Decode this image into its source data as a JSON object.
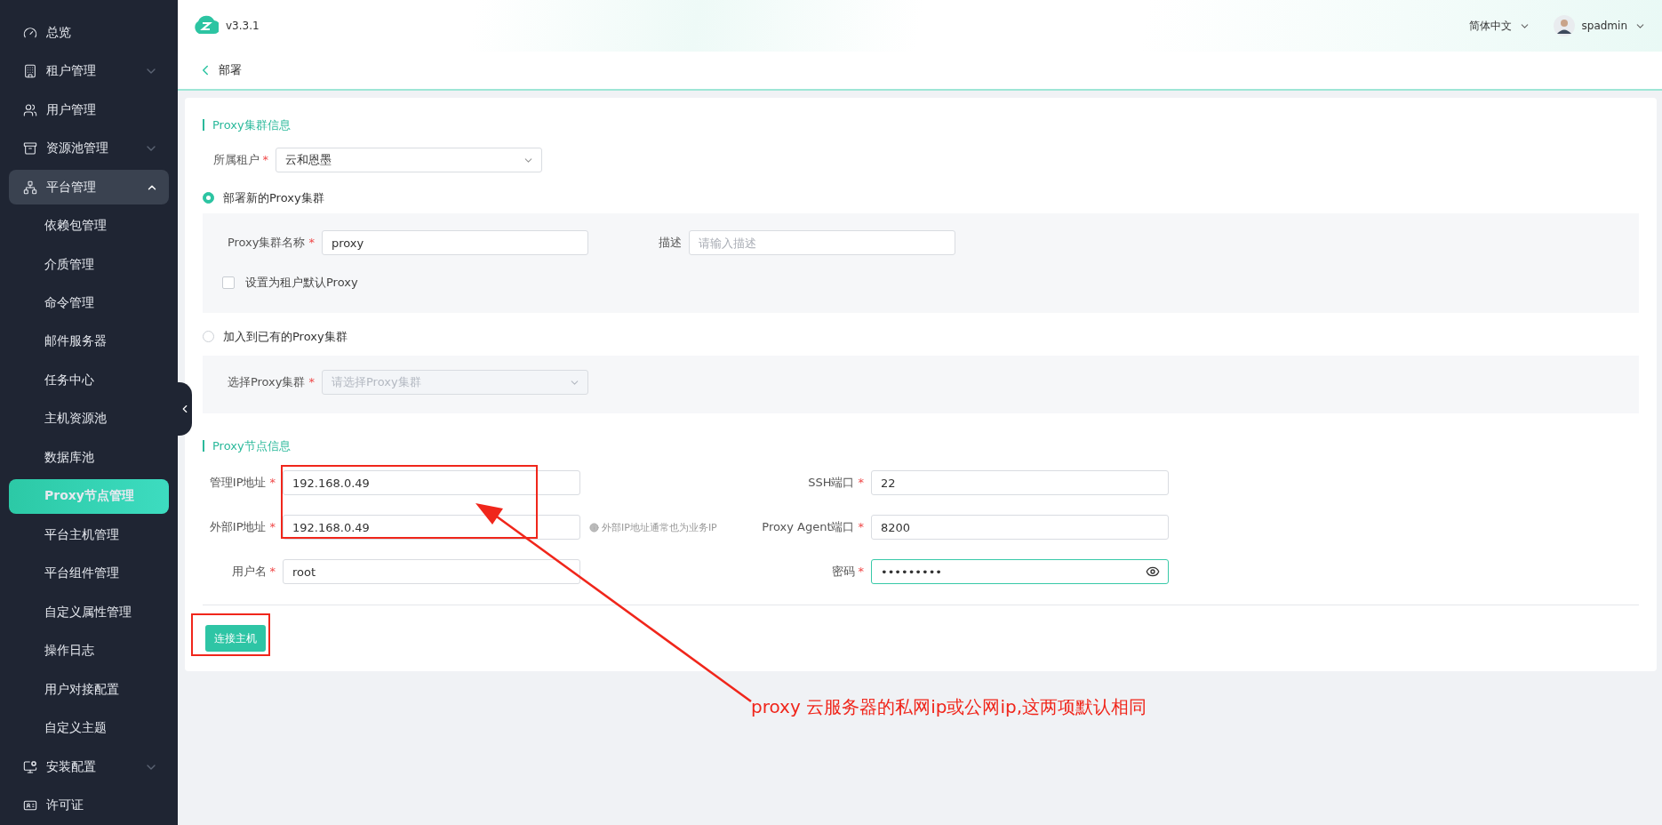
{
  "sidebar": {
    "items": [
      {
        "label": "总览",
        "selected": false
      },
      {
        "label": "租户管理",
        "selected": false,
        "expanded": false
      },
      {
        "label": "用户管理",
        "selected": false
      },
      {
        "label": "资源池管理",
        "selected": false,
        "expanded": false
      },
      {
        "label": "平台管理",
        "selected": false,
        "expanded": true,
        "children": [
          {
            "label": "依赖包管理",
            "selected": false
          },
          {
            "label": "介质管理",
            "selected": false
          },
          {
            "label": "命令管理",
            "selected": false
          },
          {
            "label": "邮件服务器",
            "selected": false
          },
          {
            "label": "任务中心",
            "selected": false
          },
          {
            "label": "主机资源池",
            "selected": false
          },
          {
            "label": "数据库池",
            "selected": false
          },
          {
            "label": "Proxy节点管理",
            "selected": true
          },
          {
            "label": "平台主机管理",
            "selected": false
          },
          {
            "label": "平台组件管理",
            "selected": false
          },
          {
            "label": "自定义属性管理",
            "selected": false
          },
          {
            "label": "操作日志",
            "selected": false
          },
          {
            "label": "用户对接配置",
            "selected": false
          },
          {
            "label": "自定义主题",
            "selected": false
          }
        ]
      },
      {
        "label": "安装配置",
        "selected": false,
        "expanded": false
      },
      {
        "label": "许可证",
        "selected": false
      }
    ]
  },
  "header": {
    "version": "v3.3.1",
    "language": "简体中文",
    "user": "spadmin"
  },
  "breadcrumb": {
    "title": "部署"
  },
  "cluster_section": {
    "title": "Proxy集群信息",
    "tenant": {
      "label": "所属租户",
      "required_mark": "*",
      "value": "云和恩墨"
    },
    "options": [
      {
        "label": "部署新的Proxy集群",
        "selected": true,
        "fields": [
          {
            "kind": "input",
            "label": "Proxy集群名称",
            "required_mark": "*",
            "value": "proxy"
          },
          {
            "kind": "input",
            "label": "描述",
            "placeholder": "请输入描述"
          }
        ],
        "checkbox": {
          "label": "设置为租户默认Proxy",
          "checked": false
        }
      },
      {
        "label": "加入到已有的Proxy集群",
        "selected": false,
        "fields": [
          {
            "kind": "select",
            "label": "选择Proxy集群",
            "required_mark": "*",
            "placeholder": "请选择Proxy集群",
            "disabled": true
          }
        ]
      }
    ]
  },
  "node_section": {
    "title": "Proxy节点信息",
    "rows": [
      {
        "left": {
          "label": "管理IP地址",
          "required_mark": "*",
          "value": "192.168.0.49"
        },
        "right": {
          "label": "SSH端口",
          "required_mark": "*",
          "value": "22"
        }
      },
      {
        "left": {
          "label": "外部IP地址",
          "required_mark": "*",
          "value": "192.168.0.49"
        },
        "hint": "外部IP地址通常也为业务IP",
        "right": {
          "label": "Proxy Agent端口",
          "required_mark": "*",
          "value": "8200"
        }
      },
      {
        "left": {
          "label": "用户名",
          "required_mark": "*",
          "value": "root"
        },
        "right": {
          "label": "密码",
          "required_mark": "*",
          "value": "•••••••••",
          "kind": "password"
        }
      }
    ],
    "button": "连接主机"
  },
  "annotation": {
    "text": "proxy 云服务器的私网ip或公网ip,这两项默认相同"
  }
}
